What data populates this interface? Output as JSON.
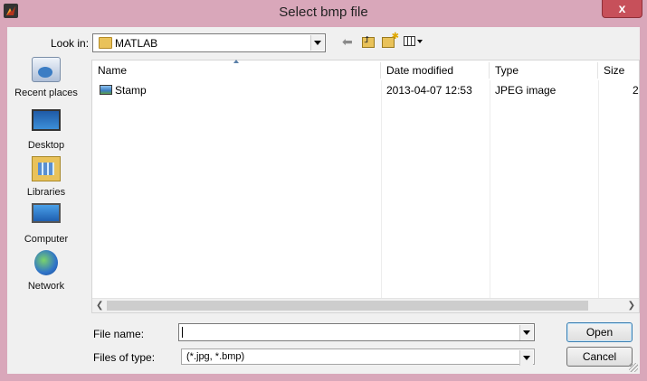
{
  "window": {
    "title": "Select bmp file",
    "close_label": "x",
    "accent": "#d9a7ba"
  },
  "toolbar": {
    "lookin_label": "Look in:",
    "lookin_value": "MATLAB"
  },
  "places": [
    {
      "label": "Recent places",
      "icon": "recent-places-icon"
    },
    {
      "label": "Desktop",
      "icon": "desktop-icon"
    },
    {
      "label": "Libraries",
      "icon": "libraries-icon"
    },
    {
      "label": "Computer",
      "icon": "computer-icon"
    },
    {
      "label": "Network",
      "icon": "network-icon"
    }
  ],
  "filelist": {
    "columns": [
      "Name",
      "Date modified",
      "Type",
      "Size"
    ],
    "rows": [
      {
        "name": "Stamp",
        "date": "2013-04-07 12:53",
        "type": "JPEG image",
        "size": "2"
      }
    ]
  },
  "footer": {
    "filename_label": "File name:",
    "filename_value": "",
    "filetype_label": "Files of type:",
    "filetype_value": "(*.jpg, *.bmp)",
    "open_label": "Open",
    "cancel_label": "Cancel"
  }
}
